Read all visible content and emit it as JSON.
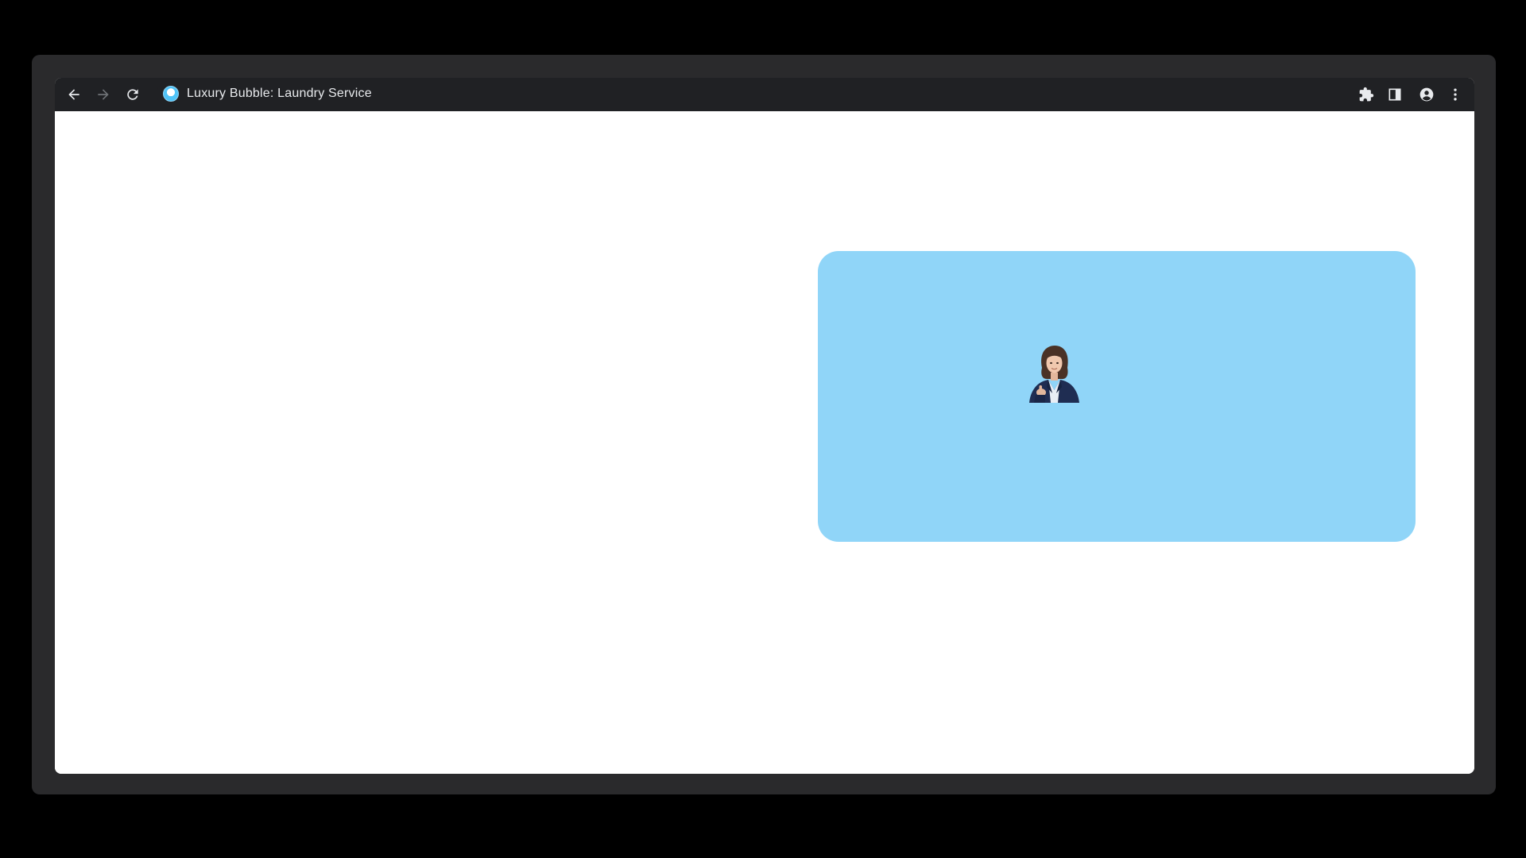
{
  "browser": {
    "page_title": "Luxury Bubble: Laundry Service",
    "icons": {
      "back": "arrow-left-icon",
      "forward": "arrow-right-icon",
      "reload": "reload-icon",
      "favicon": "favicon-icon",
      "extensions": "puzzle-icon",
      "side_panel": "side-panel-icon",
      "profile": "profile-icon",
      "menu": "kebab-menu-icon"
    }
  },
  "main": {
    "card_color": "#90d5f8",
    "avatar": "assistant-avatar-woman"
  }
}
